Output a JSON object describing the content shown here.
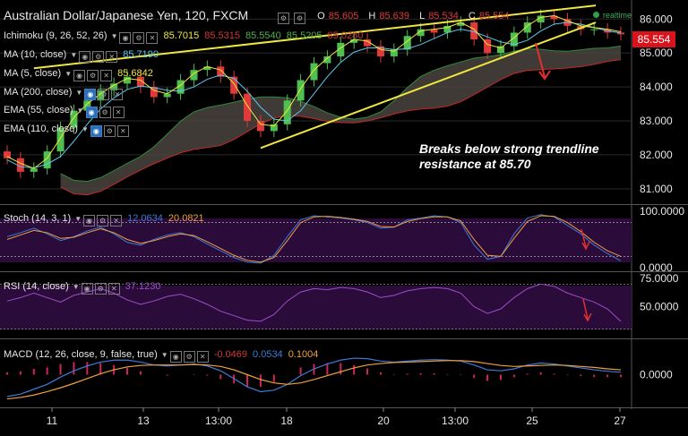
{
  "header": {
    "title": "Australian Dollar/Japanese Yen, 120, FXCM",
    "ohlc": [
      {
        "key": "O",
        "value": "85.605"
      },
      {
        "key": "H",
        "value": "85.639"
      },
      {
        "key": "L",
        "value": "85.534"
      },
      {
        "key": "C",
        "value": "85.554"
      }
    ],
    "realtime_label": "realtime"
  },
  "indicators": [
    {
      "label": "Ichimoku (9, 26, 52, 26)",
      "values": [
        {
          "v": "85.7015",
          "color": "#f0e640"
        },
        {
          "v": "85.5315",
          "color": "#d03838"
        },
        {
          "v": "85.5540",
          "color": "#4fb04f"
        },
        {
          "v": "85.5205",
          "color": "#4fb04f"
        },
        {
          "v": "85.0280",
          "color": "#d03838"
        }
      ]
    },
    {
      "label": "MA (10, close)",
      "values": [
        {
          "v": "85.7190",
          "color": "#5bc8ef"
        }
      ]
    },
    {
      "label": "MA (5, close)",
      "values": [
        {
          "v": "85.6842",
          "color": "#f0e640"
        }
      ]
    },
    {
      "label": "MA (200, close)",
      "values": []
    },
    {
      "label": "EMA (55, close)",
      "values": []
    },
    {
      "label": "EMA (110, close)",
      "values": []
    }
  ],
  "annotation": {
    "line1": "Breaks below strong trendline",
    "line2": "resistance at 85.70"
  },
  "current_price": "85.554",
  "oscillators": {
    "stoch": {
      "label": "Stoch (14, 3, 1)",
      "values": [
        {
          "v": "12.0634",
          "color": "#3d7bd6"
        },
        {
          "v": "20.0821",
          "color": "#f0a040"
        }
      ]
    },
    "rsi": {
      "label": "RSI (14, close)",
      "values": [
        {
          "v": "37.1230",
          "color": "#9b4fc8"
        }
      ]
    },
    "macd": {
      "label": "MACD (12, 26, close, 9, false, true)",
      "values": [
        {
          "v": "-0.0469",
          "color": "#d03838"
        },
        {
          "v": "0.0534",
          "color": "#3d7bd6"
        },
        {
          "v": "0.1004",
          "color": "#f0a040"
        }
      ]
    }
  },
  "colors": {
    "up": "#4fbf4f",
    "down": "#e03a3a",
    "trendline": "#f0e640",
    "cloud_fill": "#4a4440",
    "cloud_upper": "#2f8a3a",
    "cloud_lower": "#c42828",
    "ma_blue": "#5bc8ef",
    "ma_yellow": "#f0e640",
    "stoch_k": "#3d7bd6",
    "stoch_d": "#f0a040",
    "rsi": "#9b4fc8",
    "macd_line": "#3d7bd6",
    "signal_line": "#f0a040",
    "hist": "#d0245a",
    "osc_bg": "#2a0b3a",
    "grid": "#2a2a2a",
    "axis_text": "#e6e6e6"
  },
  "chart_data": [
    {
      "type": "candlestick",
      "x_tick_labels": [
        "11",
        "13",
        "13:00",
        "18",
        "20",
        "13:00",
        "25",
        "27"
      ],
      "y_tick_labels": [
        "81.000",
        "82.000",
        "83.000",
        "84.000",
        "85.000",
        "86.000"
      ],
      "ylim": [
        80.6,
        86.35
      ],
      "close_series": [
        81.9,
        81.5,
        81.6,
        82.1,
        82.8,
        83.3,
        83.6,
        83.9,
        84.1,
        84.3,
        84.0,
        83.7,
        83.8,
        84.2,
        84.5,
        84.6,
        84.3,
        83.8,
        83.0,
        82.7,
        82.9,
        83.6,
        84.2,
        84.7,
        84.9,
        85.3,
        85.4,
        85.2,
        84.9,
        85.1,
        85.5,
        85.7,
        85.6,
        85.8,
        85.9,
        85.4,
        85.0,
        85.2,
        85.6,
        85.9,
        86.1,
        86.0,
        85.8,
        85.7,
        85.7,
        85.6,
        85.55
      ],
      "trendlines": [
        {
          "from": [
            2,
            84.55
          ],
          "to": [
            46,
            86.4
          ]
        },
        {
          "from": [
            19,
            82.2
          ],
          "to": [
            46,
            85.9
          ]
        }
      ],
      "current_price": 85.554
    },
    {
      "type": "line",
      "name": "Stoch (14, 3, 1)",
      "y_tick_labels": [
        "100.0000",
        "0.0000"
      ],
      "ylim": [
        0,
        100
      ],
      "levels": [
        80,
        20
      ],
      "series": [
        {
          "name": "%K",
          "values": [
            55,
            62,
            70,
            60,
            48,
            55,
            65,
            72,
            60,
            45,
            40,
            50,
            58,
            62,
            55,
            42,
            30,
            18,
            10,
            8,
            22,
            55,
            85,
            92,
            90,
            88,
            85,
            80,
            70,
            72,
            85,
            88,
            92,
            90,
            80,
            40,
            15,
            20,
            60,
            88,
            94,
            90,
            75,
            60,
            40,
            25,
            12
          ]
        },
        {
          "name": "%D",
          "values": [
            50,
            58,
            66,
            62,
            52,
            54,
            62,
            69,
            62,
            50,
            43,
            48,
            55,
            60,
            57,
            46,
            34,
            22,
            13,
            10,
            18,
            48,
            80,
            90,
            91,
            89,
            86,
            82,
            73,
            72,
            82,
            87,
            90,
            90,
            83,
            50,
            22,
            20,
            52,
            82,
            92,
            91,
            80,
            64,
            45,
            30,
            20
          ]
        }
      ]
    },
    {
      "type": "line",
      "name": "RSI (14, close)",
      "y_tick_labels": [
        "75.0000",
        "50.0000"
      ],
      "ylim": [
        25,
        75
      ],
      "levels": [
        70,
        30
      ],
      "series": [
        {
          "name": "RSI",
          "values": [
            55,
            58,
            62,
            58,
            54,
            60,
            63,
            66,
            62,
            56,
            52,
            55,
            59,
            61,
            57,
            52,
            46,
            42,
            38,
            37,
            43,
            55,
            63,
            66,
            65,
            67,
            66,
            63,
            58,
            60,
            64,
            66,
            67,
            66,
            62,
            50,
            44,
            48,
            58,
            66,
            70,
            68,
            62,
            58,
            54,
            48,
            37
          ]
        }
      ]
    },
    {
      "type": "bar",
      "name": "MACD (12, 26, close, 9, false, true)",
      "y_tick_labels": [
        "0.0000"
      ],
      "ylim": [
        -0.6,
        0.6
      ],
      "series": [
        {
          "name": "MACD",
          "values": [
            -0.45,
            -0.4,
            -0.3,
            -0.2,
            -0.05,
            0.08,
            0.18,
            0.26,
            0.3,
            0.3,
            0.26,
            0.2,
            0.18,
            0.2,
            0.22,
            0.18,
            0.08,
            -0.08,
            -0.25,
            -0.35,
            -0.32,
            -0.2,
            -0.02,
            0.12,
            0.22,
            0.3,
            0.34,
            0.33,
            0.28,
            0.26,
            0.28,
            0.3,
            0.31,
            0.3,
            0.28,
            0.2,
            0.1,
            0.08,
            0.12,
            0.2,
            0.24,
            0.22,
            0.18,
            0.14,
            0.1,
            0.07,
            0.05
          ]
        },
        {
          "name": "Signal",
          "values": [
            -0.5,
            -0.47,
            -0.42,
            -0.35,
            -0.27,
            -0.18,
            -0.08,
            0.02,
            0.1,
            0.16,
            0.19,
            0.2,
            0.2,
            0.2,
            0.21,
            0.2,
            0.17,
            0.1,
            0.0,
            -0.1,
            -0.17,
            -0.2,
            -0.17,
            -0.1,
            -0.02,
            0.06,
            0.14,
            0.2,
            0.23,
            0.25,
            0.26,
            0.27,
            0.28,
            0.29,
            0.29,
            0.27,
            0.23,
            0.19,
            0.17,
            0.18,
            0.19,
            0.2,
            0.19,
            0.17,
            0.15,
            0.12,
            0.1
          ]
        },
        {
          "name": "Histogram",
          "values": [
            0.05,
            0.07,
            0.12,
            0.15,
            0.22,
            0.26,
            0.26,
            0.24,
            0.2,
            0.14,
            0.07,
            0.0,
            -0.02,
            0.0,
            0.01,
            -0.02,
            -0.09,
            -0.18,
            -0.25,
            -0.25,
            -0.15,
            0.0,
            0.15,
            0.22,
            0.24,
            0.24,
            0.2,
            0.13,
            0.05,
            0.01,
            0.02,
            0.03,
            0.03,
            0.01,
            -0.01,
            -0.07,
            -0.13,
            -0.11,
            -0.05,
            0.02,
            0.05,
            0.02,
            -0.01,
            -0.03,
            -0.05,
            -0.05,
            -0.05
          ]
        }
      ]
    }
  ]
}
